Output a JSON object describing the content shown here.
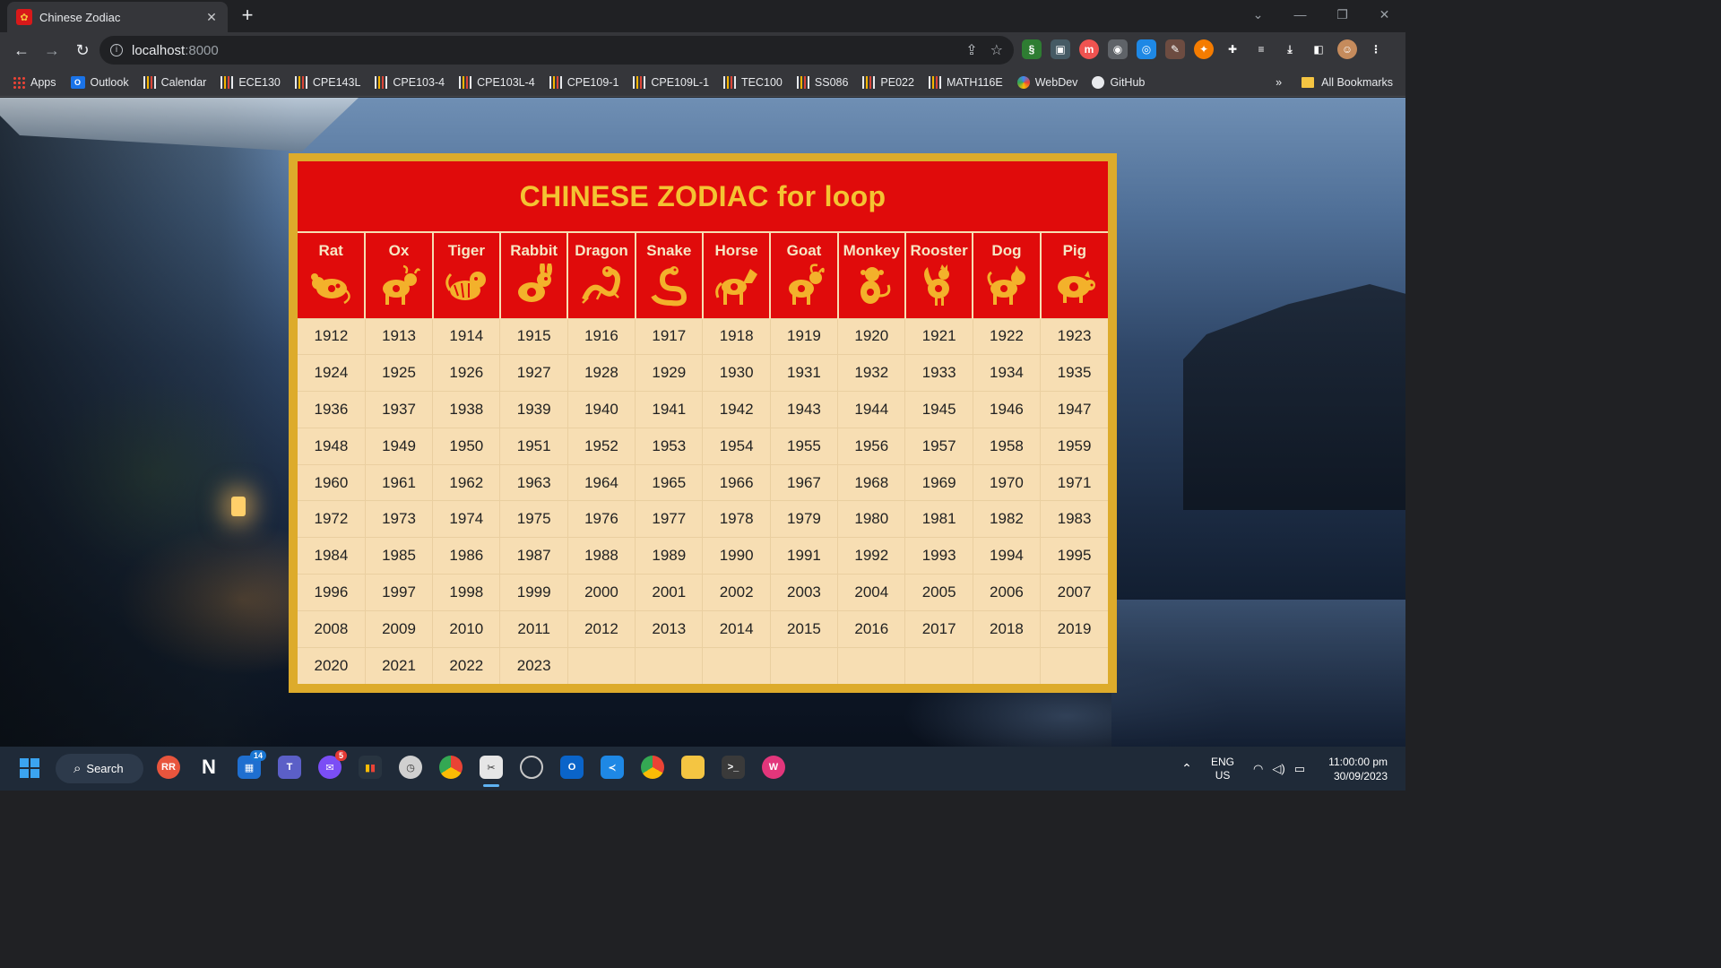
{
  "browser": {
    "tab_title": "Chinese Zodiac",
    "tab_icon": "zodiac-favicon",
    "url_host": "localhost",
    "url_port": ":8000"
  },
  "bookmarks": [
    "Apps",
    "Outlook",
    "Calendar",
    "ECE130",
    "CPE143L",
    "CPE103-4",
    "CPE103L-4",
    "CPE109-1",
    "CPE109L-1",
    "TEC100",
    "SS086",
    "PE022",
    "MATH116E",
    "WebDev",
    "GitHub"
  ],
  "bookmarks_overflow": "»",
  "all_bookmarks_label": "All Bookmarks",
  "page": {
    "title": "CHINESE ZODIAC for loop",
    "title_color": "#f4c332",
    "header_bg": "#e00b0b",
    "frame_color": "#ddab2b",
    "cell_bg": "#f7deb3",
    "animals": [
      "Rat",
      "Ox",
      "Tiger",
      "Rabbit",
      "Dragon",
      "Snake",
      "Horse",
      "Goat",
      "Monkey",
      "Rooster",
      "Dog",
      "Pig"
    ],
    "years": [
      [
        "1912",
        "1913",
        "1914",
        "1915",
        "1916",
        "1917",
        "1918",
        "1919",
        "1920",
        "1921",
        "1922",
        "1923"
      ],
      [
        "1924",
        "1925",
        "1926",
        "1927",
        "1928",
        "1929",
        "1930",
        "1931",
        "1932",
        "1933",
        "1934",
        "1935"
      ],
      [
        "1936",
        "1937",
        "1938",
        "1939",
        "1940",
        "1941",
        "1942",
        "1943",
        "1944",
        "1945",
        "1946",
        "1947"
      ],
      [
        "1948",
        "1949",
        "1950",
        "1951",
        "1952",
        "1953",
        "1954",
        "1955",
        "1956",
        "1957",
        "1958",
        "1959"
      ],
      [
        "1960",
        "1961",
        "1962",
        "1963",
        "1964",
        "1965",
        "1966",
        "1967",
        "1968",
        "1969",
        "1970",
        "1971"
      ],
      [
        "1972",
        "1973",
        "1974",
        "1975",
        "1976",
        "1977",
        "1978",
        "1979",
        "1980",
        "1981",
        "1982",
        "1983"
      ],
      [
        "1984",
        "1985",
        "1986",
        "1987",
        "1988",
        "1989",
        "1990",
        "1991",
        "1992",
        "1993",
        "1994",
        "1995"
      ],
      [
        "1996",
        "1997",
        "1998",
        "1999",
        "2000",
        "2001",
        "2002",
        "2003",
        "2004",
        "2005",
        "2006",
        "2007"
      ],
      [
        "2008",
        "2009",
        "2010",
        "2011",
        "2012",
        "2013",
        "2014",
        "2015",
        "2016",
        "2017",
        "2018",
        "2019"
      ],
      [
        "2020",
        "2021",
        "2022",
        "2023",
        "",
        "",
        "",
        "",
        "",
        "",
        "",
        ""
      ]
    ]
  },
  "taskbar": {
    "search_label": "Search",
    "teams_badge": "14",
    "messenger_badge": "5",
    "lang_top": "ENG",
    "lang_bottom": "US",
    "time": "11:00:00 pm",
    "date": "30/09/2023"
  }
}
